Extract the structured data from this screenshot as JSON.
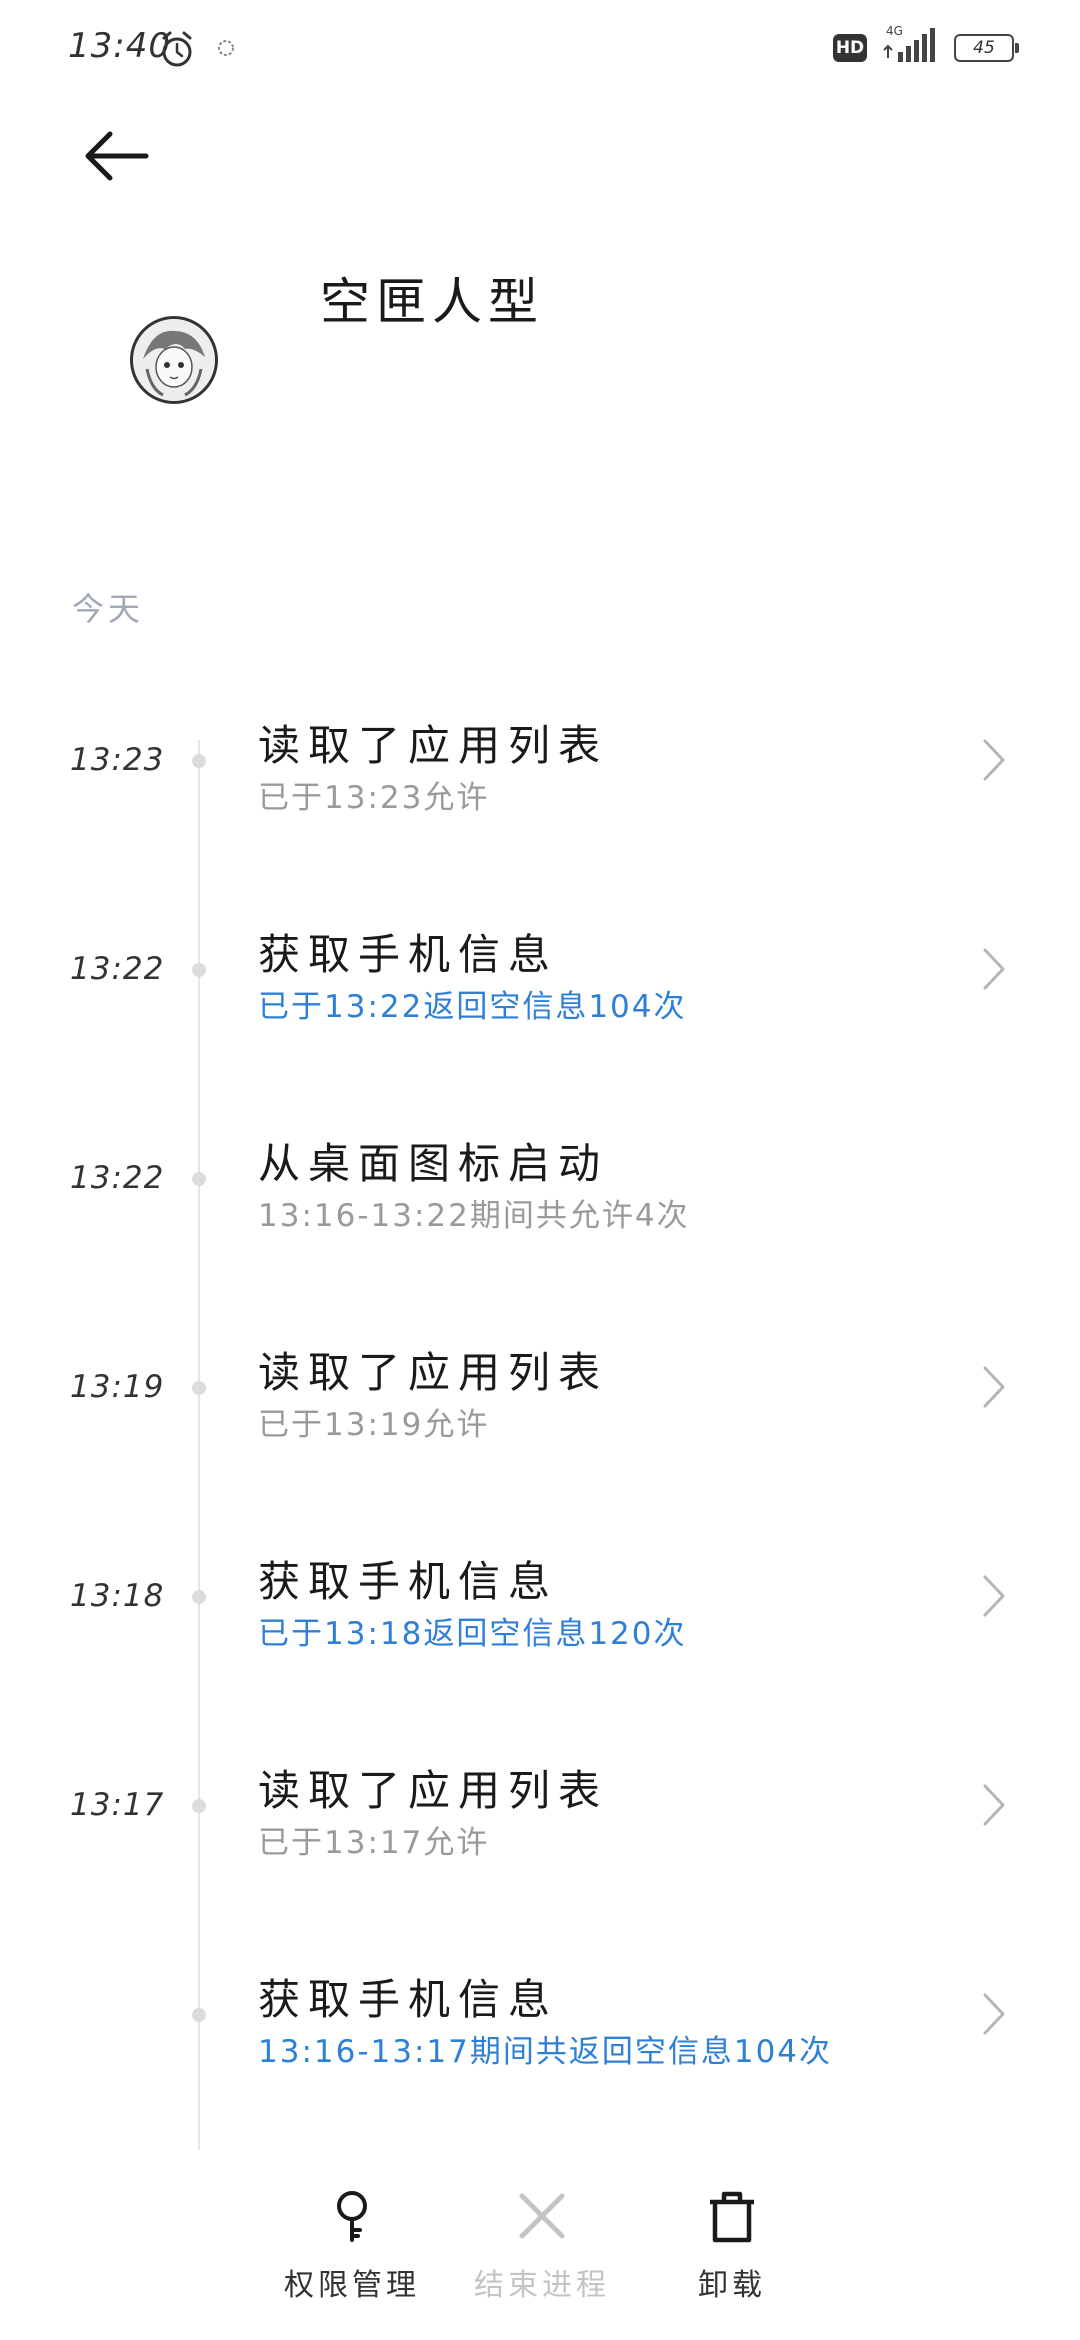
{
  "status_bar": {
    "time": "13:40",
    "hd": "HD",
    "network": "4G",
    "battery": "45"
  },
  "header": {
    "app_name": "空匣人型"
  },
  "section": {
    "date_label": "今天"
  },
  "timeline": [
    {
      "time": "13:23",
      "title": "读取了应用列表",
      "detail": "已于13:23允许",
      "detail_color": "gray",
      "has_arrow": true
    },
    {
      "time": "13:22",
      "title": "获取手机信息",
      "detail": "已于13:22返回空信息104次",
      "detail_color": "blue",
      "has_arrow": true
    },
    {
      "time": "13:22",
      "title": "从桌面图标启动",
      "detail": "13:16-13:22期间共允许4次",
      "detail_color": "gray",
      "has_arrow": false
    },
    {
      "time": "13:19",
      "title": "读取了应用列表",
      "detail": "已于13:19允许",
      "detail_color": "gray",
      "has_arrow": true
    },
    {
      "time": "13:18",
      "title": "获取手机信息",
      "detail": "已于13:18返回空信息120次",
      "detail_color": "blue",
      "has_arrow": true
    },
    {
      "time": "13:17",
      "title": "读取了应用列表",
      "detail": "已于13:17允许",
      "detail_color": "gray",
      "has_arrow": true
    },
    {
      "time": "",
      "title": "获取手机信息",
      "detail": "13:16-13:17期间共返回空信息104次",
      "detail_color": "blue",
      "has_arrow": true
    }
  ],
  "bottom_bar": {
    "permissions_label": "权限管理",
    "end_process_label": "结束进程",
    "uninstall_label": "卸载"
  },
  "colors": {
    "accent_blue": "#2e7fd6",
    "muted_gray": "#9a9a9a",
    "date_gray": "#a0a8b6",
    "disabled_gray": "#c4c4c4"
  }
}
